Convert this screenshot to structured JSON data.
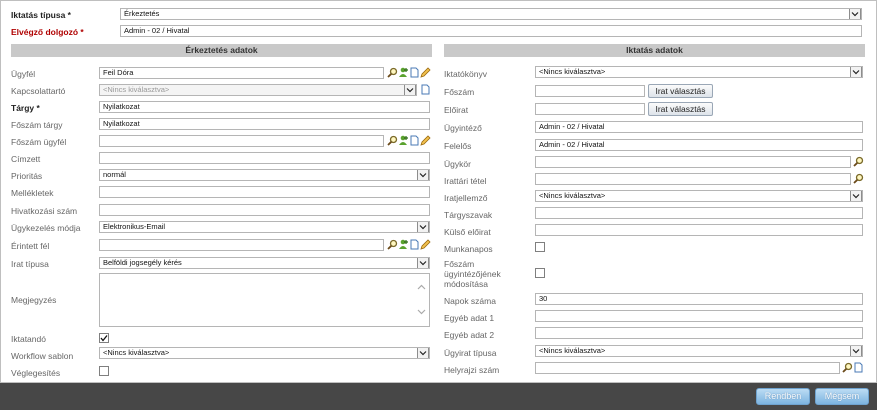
{
  "top": {
    "type_label": "Iktatás típusa *",
    "type_value": "Érkeztetés",
    "clerk_label": "Elvégző dolgozó *",
    "clerk_value": "Admin - 02 / Hivatal"
  },
  "left": {
    "header": "Érkeztetés adatok",
    "ugyfel": {
      "label": "Ügyfél",
      "value": "Feil Dóra"
    },
    "kapcsolattarto": {
      "label": "Kapcsolattartó",
      "placeholder": "<Nincs kiválasztva>"
    },
    "targy": {
      "label": "Tárgy *",
      "value": "Nyilatkozat"
    },
    "foszam_targy": {
      "label": "Főszám tárgy",
      "value": "Nyilatkozat"
    },
    "foszam_ugyfel": {
      "label": "Főszám ügyfél",
      "value": ""
    },
    "cimzett": {
      "label": "Címzett",
      "value": ""
    },
    "prioritas": {
      "label": "Prioritás",
      "value": "normál"
    },
    "mellekletek": {
      "label": "Mellékletek",
      "value": ""
    },
    "hivatkozasi_szam": {
      "label": "Hivatkozási szám",
      "value": ""
    },
    "ugykezeles_modja": {
      "label": "Ügykezelés módja",
      "value": "Elektronikus-Email"
    },
    "erintett_fel": {
      "label": "Érintett fél",
      "value": ""
    },
    "irat_tipusa": {
      "label": "Irat típusa",
      "value": "Belföldi jogsegély kérés"
    },
    "megjegyzes": {
      "label": "Megjegyzés",
      "value": ""
    },
    "iktatando": {
      "label": "Iktatandó",
      "checked": true
    },
    "workflow_sablon": {
      "label": "Workflow sablon",
      "value": "<Nincs kiválasztva>"
    },
    "veglegesites": {
      "label": "Véglegesítés",
      "checked": false
    }
  },
  "right": {
    "header": "Iktatás adatok",
    "iktatokonyv": {
      "label": "Iktatókönyv",
      "value": "<Nincs kiválasztva>"
    },
    "foszam": {
      "label": "Főszám",
      "value": "",
      "button": "Irat választás"
    },
    "eloirat": {
      "label": "Előirat",
      "value": "",
      "button": "Irat választás"
    },
    "ugyintezo": {
      "label": "Ügyintéző",
      "value": "Admin - 02 / Hivatal"
    },
    "felelos": {
      "label": "Felelős",
      "value": "Admin - 02 / Hivatal"
    },
    "ugykor": {
      "label": "Ügykör",
      "value": ""
    },
    "irattari_tetel": {
      "label": "Irattári tétel",
      "value": ""
    },
    "iratjellemzo": {
      "label": "Iratjellemző",
      "value": "<Nincs kiválasztva>"
    },
    "targyszavak": {
      "label": "Tárgyszavak",
      "value": ""
    },
    "kulso_eloirat": {
      "label": "Külső előirat",
      "value": ""
    },
    "munkanapos": {
      "label": "Munkanapos",
      "checked": false
    },
    "foszam_mod": {
      "label1": "Főszám",
      "label2": "ügyintézőjének",
      "label3": "módosítása",
      "checked": false
    },
    "napok_szama": {
      "label": "Napok száma",
      "value": "30"
    },
    "egyeb1": {
      "label": "Egyéb adat 1",
      "value": ""
    },
    "egyeb2": {
      "label": "Egyéb adat 2",
      "value": ""
    },
    "ugyirat_tipusa": {
      "label": "Ügyirat típusa",
      "value": "<Nincs kiválasztva>"
    },
    "helyrajzi_szam": {
      "label": "Helyrajzi szám",
      "value": ""
    }
  },
  "footer": {
    "ok": "Rendben",
    "cancel": "Mégsem"
  },
  "colors": {
    "required": "#b00000",
    "header_bg": "#c9c9c9",
    "footer_button": "#7db4e0",
    "backdrop": "#474747"
  }
}
